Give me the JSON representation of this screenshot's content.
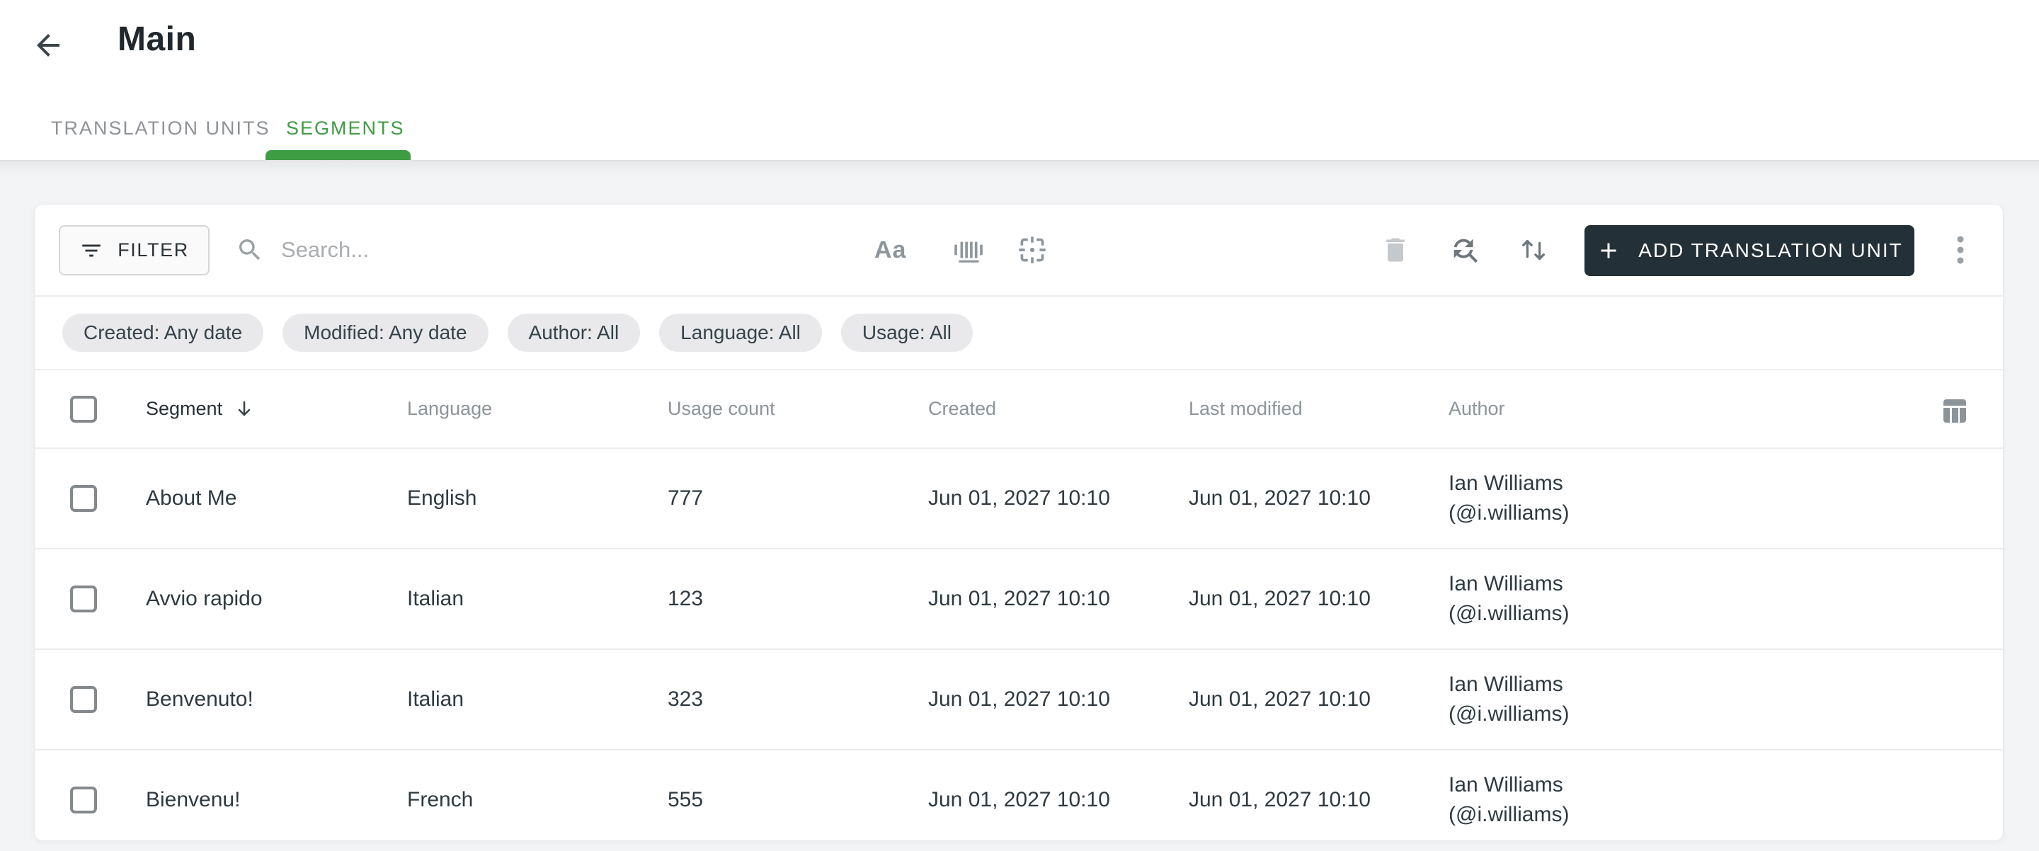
{
  "header": {
    "title": "Main",
    "back_icon": "arrow-left-icon"
  },
  "tabs": [
    {
      "label": "TRANSLATION UNITS",
      "active": false
    },
    {
      "label": "SEGMENTS",
      "active": true
    }
  ],
  "toolbar": {
    "filter_label": "FILTER",
    "search_placeholder": "Search...",
    "match_case_label": "Aa",
    "icons": [
      "filter-icon",
      "search-icon",
      "match-case-icon",
      "barcode-icon",
      "frame-scan-icon",
      "trash-icon",
      "find-replace-icon",
      "sort-arrows-icon",
      "plus-icon",
      "kebab-menu-icon"
    ],
    "add_button_label": "ADD TRANSLATION UNIT"
  },
  "filter_chips": [
    "Created: Any date",
    "Modified: Any date",
    "Author: All",
    "Language: All",
    "Usage: All"
  ],
  "table": {
    "columns": [
      "Segment",
      "Language",
      "Usage count",
      "Created",
      "Last modified",
      "Author"
    ],
    "sorted_column": "Segment",
    "sort_direction": "descending",
    "rows": [
      {
        "segment": "About Me",
        "language": "English",
        "usage_count": "777",
        "created": "Jun 01, 2027 10:10",
        "last_modified": "Jun 01, 2027 10:10",
        "author_name": "Ian Williams",
        "author_handle": "(@i.williams)"
      },
      {
        "segment": "Avvio rapido",
        "language": "Italian",
        "usage_count": "123",
        "created": "Jun 01, 2027 10:10",
        "last_modified": "Jun 01, 2027 10:10",
        "author_name": "Ian Williams",
        "author_handle": "(@i.williams)"
      },
      {
        "segment": "Benvenuto!",
        "language": "Italian",
        "usage_count": "323",
        "created": "Jun 01, 2027 10:10",
        "last_modified": "Jun 01, 2027 10:10",
        "author_name": "Ian Williams",
        "author_handle": "(@i.williams)"
      },
      {
        "segment": "Bienvenu!",
        "language": "French",
        "usage_count": "555",
        "created": "Jun 01, 2027 10:10",
        "last_modified": "Jun 01, 2027 10:10",
        "author_name": "Ian Williams",
        "author_handle": "(@i.williams)"
      }
    ]
  },
  "colors": {
    "accent_green": "#3e9c43",
    "dark_button": "#243037",
    "chip_background": "#e9e9eb",
    "page_background": "#f3f4f6"
  }
}
